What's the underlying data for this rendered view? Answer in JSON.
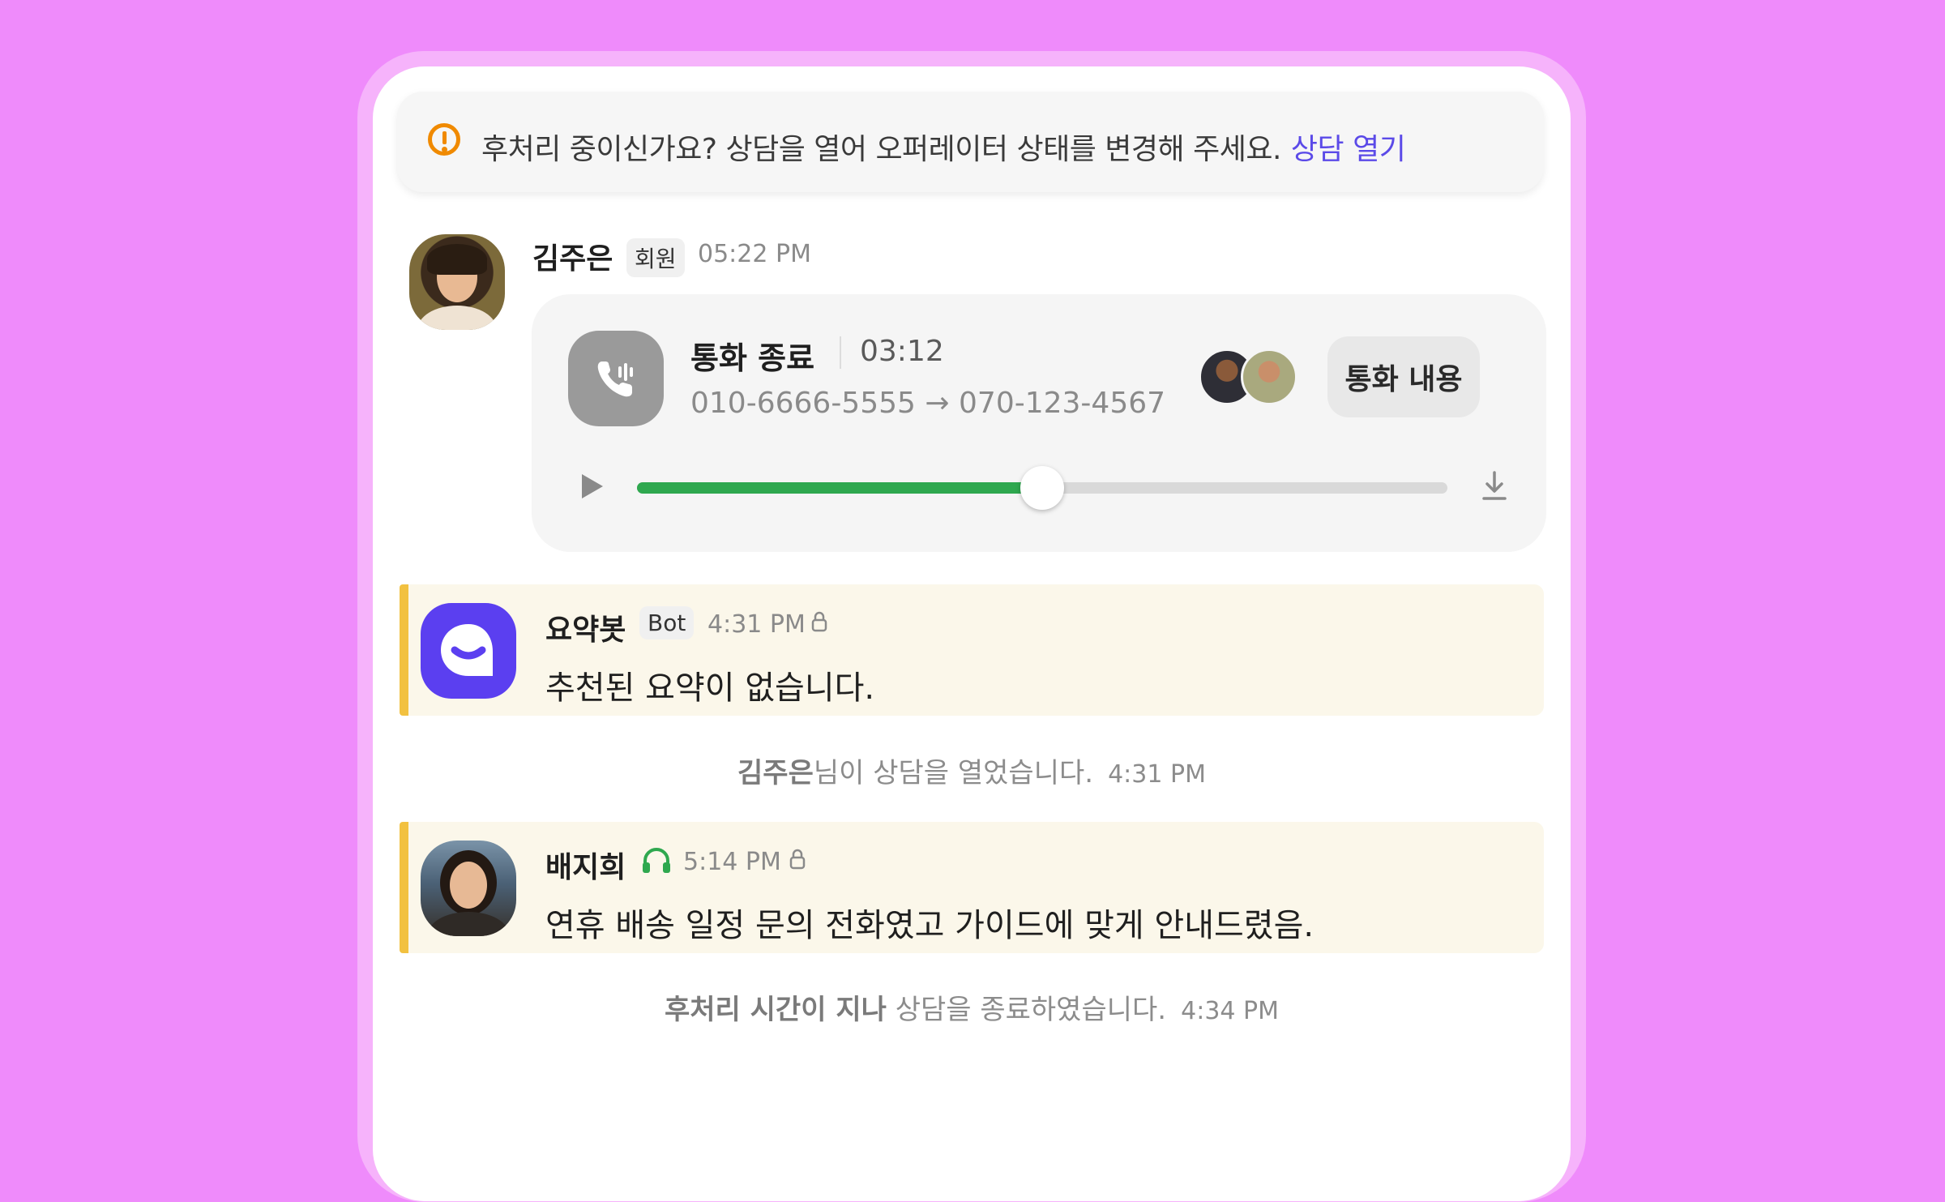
{
  "banner": {
    "icon": "warning-circle-icon",
    "message": "후처리 중이신가요? 상담을 열어 오퍼레이터 상태를 변경해 주세요.",
    "link": "상담 열기",
    "accent": "#f08a00",
    "link_color": "#5b4ae8"
  },
  "call_message": {
    "sender": "김주은",
    "badge": "회원",
    "time": "05:22 PM",
    "card": {
      "title": "통화 종료",
      "duration": "03:12",
      "from": "010-6666-5555",
      "arrow": "→",
      "to": "070-123-4567",
      "button": "통화 내용",
      "progress": 0.5,
      "progress_color": "#2fa84f"
    }
  },
  "bot_message": {
    "sender": "요약봇",
    "badge": "Bot",
    "time": "4:31 PM",
    "text": "추천된 요약이 없습니다."
  },
  "system_open": {
    "name": "김주은",
    "text": "님이 상담을 열었습니다.",
    "time": "4:31 PM"
  },
  "agent_message": {
    "sender": "배지희",
    "time": "5:14 PM",
    "text": "연휴 배송 일정 문의 전화였고 가이드에 맞게 안내드렸음."
  },
  "system_close": {
    "name": "후처리 시간이 지나",
    "text": " 상담을 종료하였습니다.",
    "time": "4:34 PM"
  },
  "colors": {
    "page_bg": "#ef8bfb",
    "note_bg": "#fbf7ea",
    "note_accent": "#f2c140",
    "bot_purple": "#5b3ff0"
  }
}
